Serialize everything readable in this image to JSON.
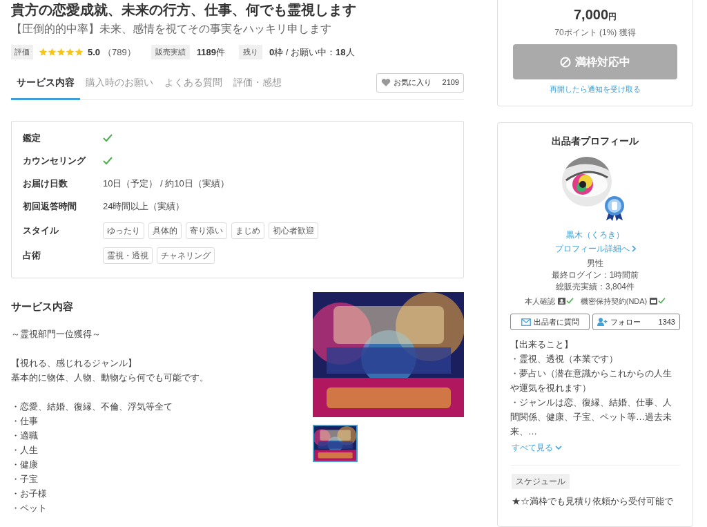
{
  "title": "貴方の恋愛成就、未来の行方、仕事、何でも霊視します",
  "subtitle": "【圧倒的的中率】未来、感情を視てその事実をハッキリ申します",
  "stats": {
    "rating_label": "評価",
    "stars": 5,
    "rating": "5.0",
    "review_count": "（789）",
    "sales_label": "販売実績",
    "sales": "**1189**件",
    "remaining_label": "残り",
    "remaining": "**0**枠 / お願い中：**18**人"
  },
  "tabs": [
    {
      "label": "サービス内容",
      "selected": true
    },
    {
      "label": "購入時のお願い",
      "selected": false
    },
    {
      "label": "よくある質問",
      "selected": false
    },
    {
      "label": "評価・感想",
      "selected": false
    }
  ],
  "favorite": {
    "label": "お気に入り",
    "count": "2109"
  },
  "details": [
    {
      "label": "鑑定",
      "kind": "check"
    },
    {
      "label": "カウンセリング",
      "kind": "check"
    },
    {
      "label": "お届け日数",
      "kind": "text",
      "value": "10日（予定） / 約10日（実績）"
    },
    {
      "label": "初回返答時間",
      "kind": "text",
      "value": "24時間以上（実績）"
    },
    {
      "label": "スタイル",
      "kind": "tags",
      "tags": [
        "ゆったり",
        "具体的",
        "寄り添い",
        "まじめ",
        "初心者歓迎"
      ]
    },
    {
      "label": "占術",
      "kind": "tags",
      "tags": [
        "霊視・透視",
        "チャネリング"
      ]
    }
  ],
  "description": {
    "heading": "サービス内容",
    "paragraphs": [
      [
        "～霊視部門一位獲得～"
      ],
      [
        "【視れる、感じれるジャンル】",
        "基本的に物体、人物、動物なら何でも可能です。"
      ],
      [
        "・恋愛、結婚、復縁、不倫、浮気等全て",
        "・仕事",
        "・適職",
        "・人生",
        "・健康",
        "・子宝",
        "・お子様",
        "・ペット"
      ]
    ]
  },
  "gallery": {
    "thumbnails": [
      {
        "selected": true
      }
    ]
  },
  "purchase": {
    "price": "7,000",
    "currency": "円",
    "points": "70ポイント (1%) 獲得",
    "button": "満枠対応中",
    "disabled": true,
    "notify_link": "再開したら通知を受け取る"
  },
  "profile": {
    "heading": "出品者プロフィール",
    "name": "黒木（くろき）",
    "detail_link": "プロフィール詳細へ",
    "gender": "男性",
    "last_login": "最終ログイン：1時間前",
    "total_sales": "総販売実績：3,804件",
    "verifications": [
      {
        "label": "本人確認",
        "kind": "id",
        "checked": true
      },
      {
        "label": "機密保持契約(NDA)",
        "kind": "nda",
        "checked": true
      }
    ],
    "ask_button": "出品者に質問",
    "follow_button": "フォロー",
    "follow_count": "1343",
    "bio": [
      "【出来ること】",
      "・霊視、透視（本業です）",
      "・夢占い（潜在意識からこれからの人生や運気を視れます）",
      "・ジャンルは恋、復縁、結婚、仕事、人間関係、健康、子宝、ペット等…過去未来、…"
    ],
    "more_link": "すべて見る",
    "schedule_label": "スケジュール",
    "schedule_text": "★☆満枠でも見積り依頼から受付可能で"
  }
}
